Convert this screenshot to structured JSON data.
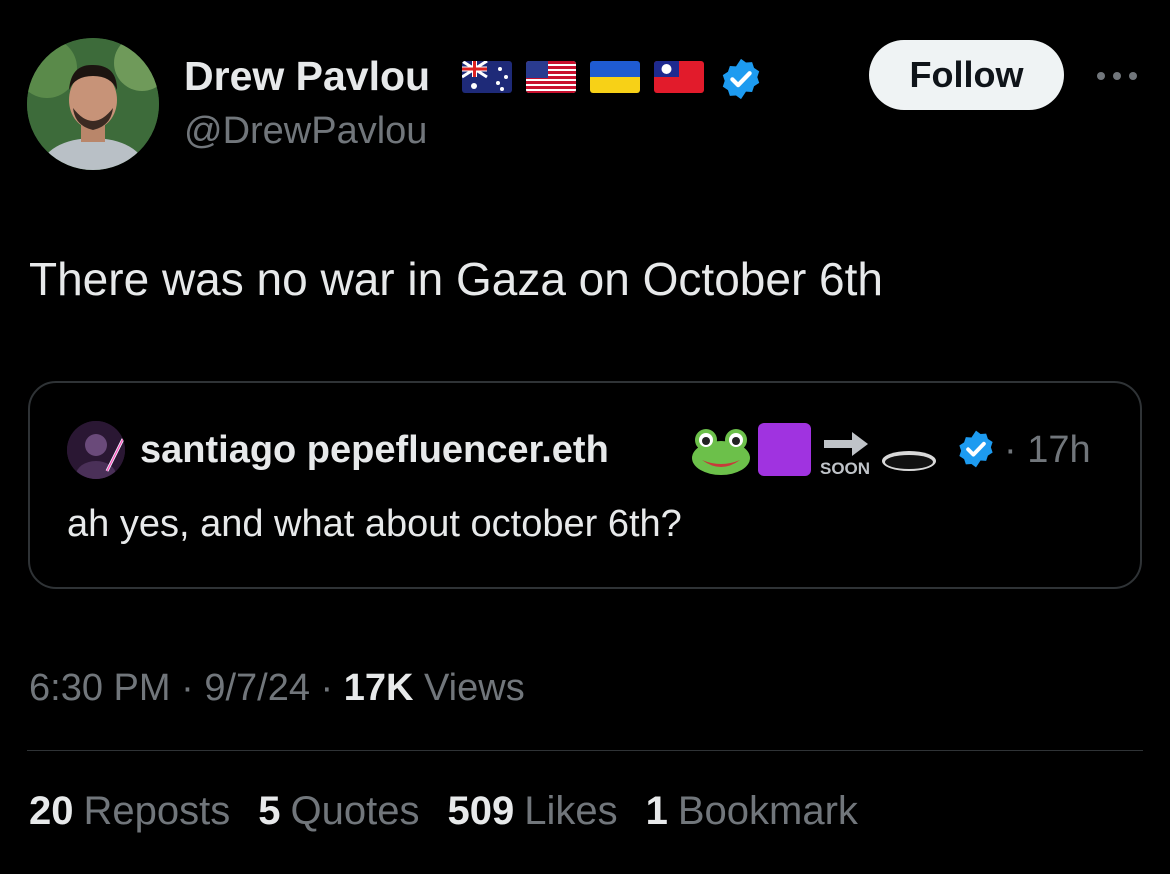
{
  "author": {
    "display_name": "Drew Pavlou",
    "handle": "@DrewPavlou",
    "flag_icons": [
      "australia-flag-icon",
      "usa-flag-icon",
      "ukraine-flag-icon",
      "taiwan-flag-icon"
    ],
    "verified": true
  },
  "follow_label": "Follow",
  "tweet": {
    "text": "There was no war in Gaza on October 6th"
  },
  "quoted": {
    "display_name": "santiago pepefluencer.eth",
    "name_icons": [
      "frog-face-icon",
      "purple-square-icon",
      "soon-arrow-icon",
      "hole-icon"
    ],
    "verified": true,
    "time": "· 17h",
    "text": "ah yes, and what about october 6th?"
  },
  "meta": {
    "time": "6:30 PM",
    "sep1": " · ",
    "date": "9/7/24",
    "sep2": " · ",
    "views_count": "17K",
    "views_label": " Views"
  },
  "stats": [
    {
      "count": "20",
      "label": "Reposts"
    },
    {
      "count": "5",
      "label": "Quotes"
    },
    {
      "count": "509",
      "label": "Likes"
    },
    {
      "count": "1",
      "label": "Bookmark"
    }
  ],
  "colors": {
    "background": "#000000",
    "text": "#e7e9ea",
    "muted": "#71767b",
    "border": "#2f3336",
    "verified": "#1d9bf0",
    "button_bg": "#eff3f4"
  }
}
